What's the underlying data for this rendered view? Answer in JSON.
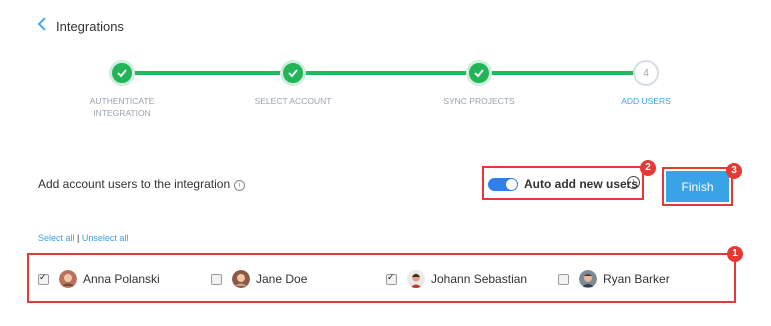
{
  "header": {
    "title": "Integrations"
  },
  "steps": [
    {
      "label_line1": "AUTHENTICATE",
      "label_line2": "INTEGRATION",
      "state": "done"
    },
    {
      "label_line1": "SELECT ACCOUNT",
      "label_line2": "",
      "state": "done"
    },
    {
      "label_line1": "SYNC PROJECTS",
      "label_line2": "",
      "state": "done"
    },
    {
      "label_line1": "ADD USERS",
      "label_line2": "",
      "state": "current",
      "number": "4"
    }
  ],
  "section": {
    "heading": "Add account users to the integration",
    "info": "i"
  },
  "auto_add": {
    "label": "Auto add new users",
    "enabled": true,
    "info": "i"
  },
  "finish": {
    "label": "Finish"
  },
  "badges": [
    "1",
    "2",
    "3"
  ],
  "selection": {
    "select_all": "Select all",
    "separator": "|",
    "unselect_all": "Unselect all"
  },
  "users": [
    {
      "name": "Anna Polanski",
      "checked": true
    },
    {
      "name": "Jane Doe",
      "checked": false
    },
    {
      "name": "Johann Sebastian",
      "checked": true
    },
    {
      "name": "Ryan Barker",
      "checked": false
    }
  ],
  "colors": {
    "accent": "#3aa3e8",
    "success": "#22b457",
    "annotation": "#e53935",
    "toggle": "#2f80ed"
  }
}
